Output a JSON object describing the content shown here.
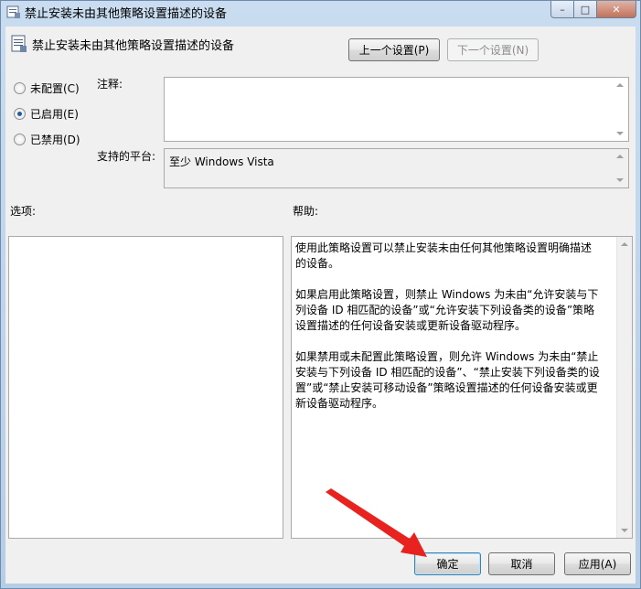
{
  "window": {
    "title": "禁止安装未由其他策略设置描述的设备",
    "controls": {
      "minimize": "–",
      "maximize": "□",
      "close": "✕"
    }
  },
  "header": {
    "policy_title": "禁止安装未由其他策略设置描述的设备",
    "prev_button": "上一个设置(P)",
    "next_button": "下一个设置(N)"
  },
  "state": {
    "options": [
      {
        "label": "未配置(C)",
        "selected": false
      },
      {
        "label": "已启用(E)",
        "selected": true
      },
      {
        "label": "已禁用(D)",
        "selected": false
      }
    ]
  },
  "comment": {
    "label": "注释:",
    "value": ""
  },
  "platform": {
    "label": "支持的平台:",
    "value": "至少 Windows Vista"
  },
  "options_panel": {
    "label": "选项:"
  },
  "help_panel": {
    "label": "帮助:",
    "paragraphs": [
      "使用此策略设置可以禁止安装未由任何其他策略设置明确描述的设备。",
      "如果启用此策略设置，则禁止 Windows 为未由“允许安装与下列设备 ID 相匹配的设备”或“允许安装下列设备类的设备”策略设置描述的任何设备安装或更新设备驱动程序。",
      "如果禁用或未配置此策略设置，则允许 Windows 为未由“禁止安装与下列设备 ID 相匹配的设备”、“禁止安装下列设备类的设置”或“禁止安装可移动设备”策略设置描述的任何设备安装或更新设备驱动程序。"
    ]
  },
  "footer": {
    "ok_button": "确定",
    "cancel_button": "取消",
    "apply_button": "应用(A)"
  },
  "colors": {
    "annotation_arrow": "#e8231f",
    "accent": "#3c7fb1"
  }
}
